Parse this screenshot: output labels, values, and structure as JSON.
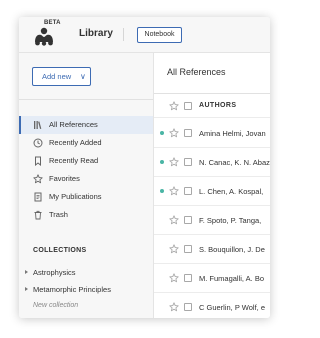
{
  "header": {
    "beta_label": "BETA",
    "title": "Library",
    "notebook_label": "Notebook"
  },
  "sidebar": {
    "add_new_label": "Add new",
    "items": [
      {
        "label": "All References",
        "icon": "library-icon",
        "active": true
      },
      {
        "label": "Recently Added",
        "icon": "clock-icon",
        "active": false
      },
      {
        "label": "Recently Read",
        "icon": "bookmark-icon",
        "active": false
      },
      {
        "label": "Favorites",
        "icon": "star-icon",
        "active": false
      },
      {
        "label": "My Publications",
        "icon": "publications-icon",
        "active": false
      },
      {
        "label": "Trash",
        "icon": "trash-icon",
        "active": false
      }
    ],
    "collections_heading": "COLLECTIONS",
    "collections": [
      {
        "label": "Astrophysics"
      },
      {
        "label": "Metamorphic Principles"
      }
    ],
    "new_collection_label": "New collection"
  },
  "main": {
    "title": "All References",
    "columns": {
      "authors": "AUTHORS"
    },
    "rows": [
      {
        "authors": "Amina Helmi, Jovan",
        "unread": true
      },
      {
        "authors": "N. Canac, K. N. Abaz",
        "unread": true
      },
      {
        "authors": "L. Chen, A. Kospal,",
        "unread": true
      },
      {
        "authors": "F. Spoto, P. Tanga,",
        "unread": false
      },
      {
        "authors": "S. Bouquillon, J. De",
        "unread": false
      },
      {
        "authors": "M. Fumagalli, A. Bo",
        "unread": false
      },
      {
        "authors": "C Guerlin, P Wolf, e",
        "unread": false
      }
    ]
  },
  "colors": {
    "accent": "#3d6bb3",
    "unread_dot": "#4ab5a5",
    "active_bg": "#e5ecf6",
    "sidebar_bg": "#f7f7f7"
  }
}
